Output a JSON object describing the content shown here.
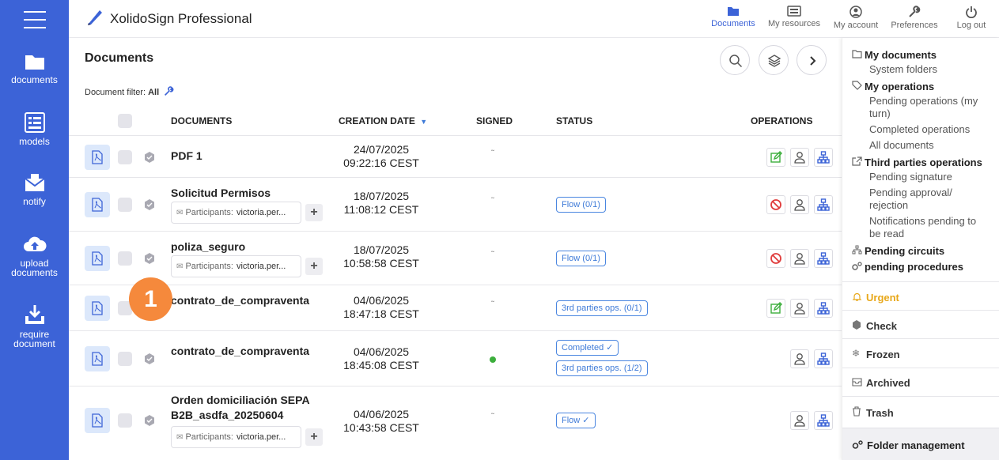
{
  "app": {
    "title": "XolidoSign Professional"
  },
  "sidebar": {
    "items": [
      {
        "label": "documents"
      },
      {
        "label": "models"
      },
      {
        "label": "notify"
      },
      {
        "label": "upload documents"
      },
      {
        "label": "require document"
      }
    ]
  },
  "topnav": [
    {
      "label": "Documents"
    },
    {
      "label": "My resources"
    },
    {
      "label": "My account"
    },
    {
      "label": "Preferences"
    },
    {
      "label": "Log out"
    }
  ],
  "main": {
    "title": "Documents",
    "filter_label": "Document filter:",
    "filter_value": "All"
  },
  "table": {
    "columns": [
      "DOCUMENTS",
      "CREATION DATE",
      "SIGNED",
      "STATUS",
      "OPERATIONS"
    ],
    "rows": [
      {
        "name": "PDF 1",
        "date": "24/07/2025",
        "time": "09:22:16 CEST",
        "signed": "",
        "statuses": [],
        "ops": [
          "edit",
          "user",
          "tree"
        ]
      },
      {
        "name": "Solicitud Permisos",
        "date": "18/07/2025",
        "time": "11:08:12 CEST",
        "participants_label": "Participants:",
        "participants": "victoria.per...",
        "signed": "",
        "statuses": [
          "Flow (0/1)"
        ],
        "ops": [
          "ban",
          "user",
          "tree"
        ]
      },
      {
        "name": "poliza_seguro",
        "date": "18/07/2025",
        "time": "10:58:58 CEST",
        "participants_label": "Participants:",
        "participants": "victoria.per...",
        "signed": "",
        "statuses": [
          "Flow (0/1)"
        ],
        "ops": [
          "ban",
          "user",
          "tree"
        ]
      },
      {
        "name": "contrato_de_compraventa",
        "date": "04/06/2025",
        "time": "18:47:18 CEST",
        "signed": "",
        "statuses": [
          "3rd parties ops. (0/1)"
        ],
        "ops": [
          "edit",
          "user",
          "tree"
        ]
      },
      {
        "name": "contrato_de_compraventa",
        "date": "04/06/2025",
        "time": "18:45:08 CEST",
        "signed": "signed",
        "statuses": [
          "Completed ✓",
          "3rd parties ops. (1/2)"
        ],
        "ops": [
          "user",
          "tree"
        ]
      },
      {
        "name": "Orden domiciliación SEPA B2B_asdfa_20250604",
        "date": "04/06/2025",
        "time": "10:43:58 CEST",
        "participants_label": "Participants:",
        "participants": "victoria.per...",
        "signed": "",
        "statuses": [
          "Flow ✓"
        ],
        "ops": [
          "user",
          "tree"
        ]
      }
    ]
  },
  "right_panel": {
    "my_documents": "My documents",
    "system_folders": "System folders",
    "my_operations": "My operations",
    "pending_ops": "Pending operations (my turn)",
    "completed_ops": "Completed operations",
    "all_documents": "All documents",
    "third_parties": "Third parties operations",
    "pending_signature": "Pending signature",
    "pending_approval": "Pending approval/ rejection",
    "notifications_pending": "Notifications pending to be read",
    "pending_circuits": "Pending circuits",
    "pending_procedures": "pending procedures",
    "urgent": "Urgent",
    "check": "Check",
    "frozen": "Frozen",
    "archived": "Archived",
    "trash": "Trash",
    "folder_management": "Folder management"
  },
  "step_badge": "1",
  "colors": {
    "sidebar": "#3c63d7",
    "accent": "#3f7bd8",
    "urgent": "#e8a81a",
    "green": "#3cae3c",
    "red": "#e03c3c",
    "step": "#f5893c"
  }
}
